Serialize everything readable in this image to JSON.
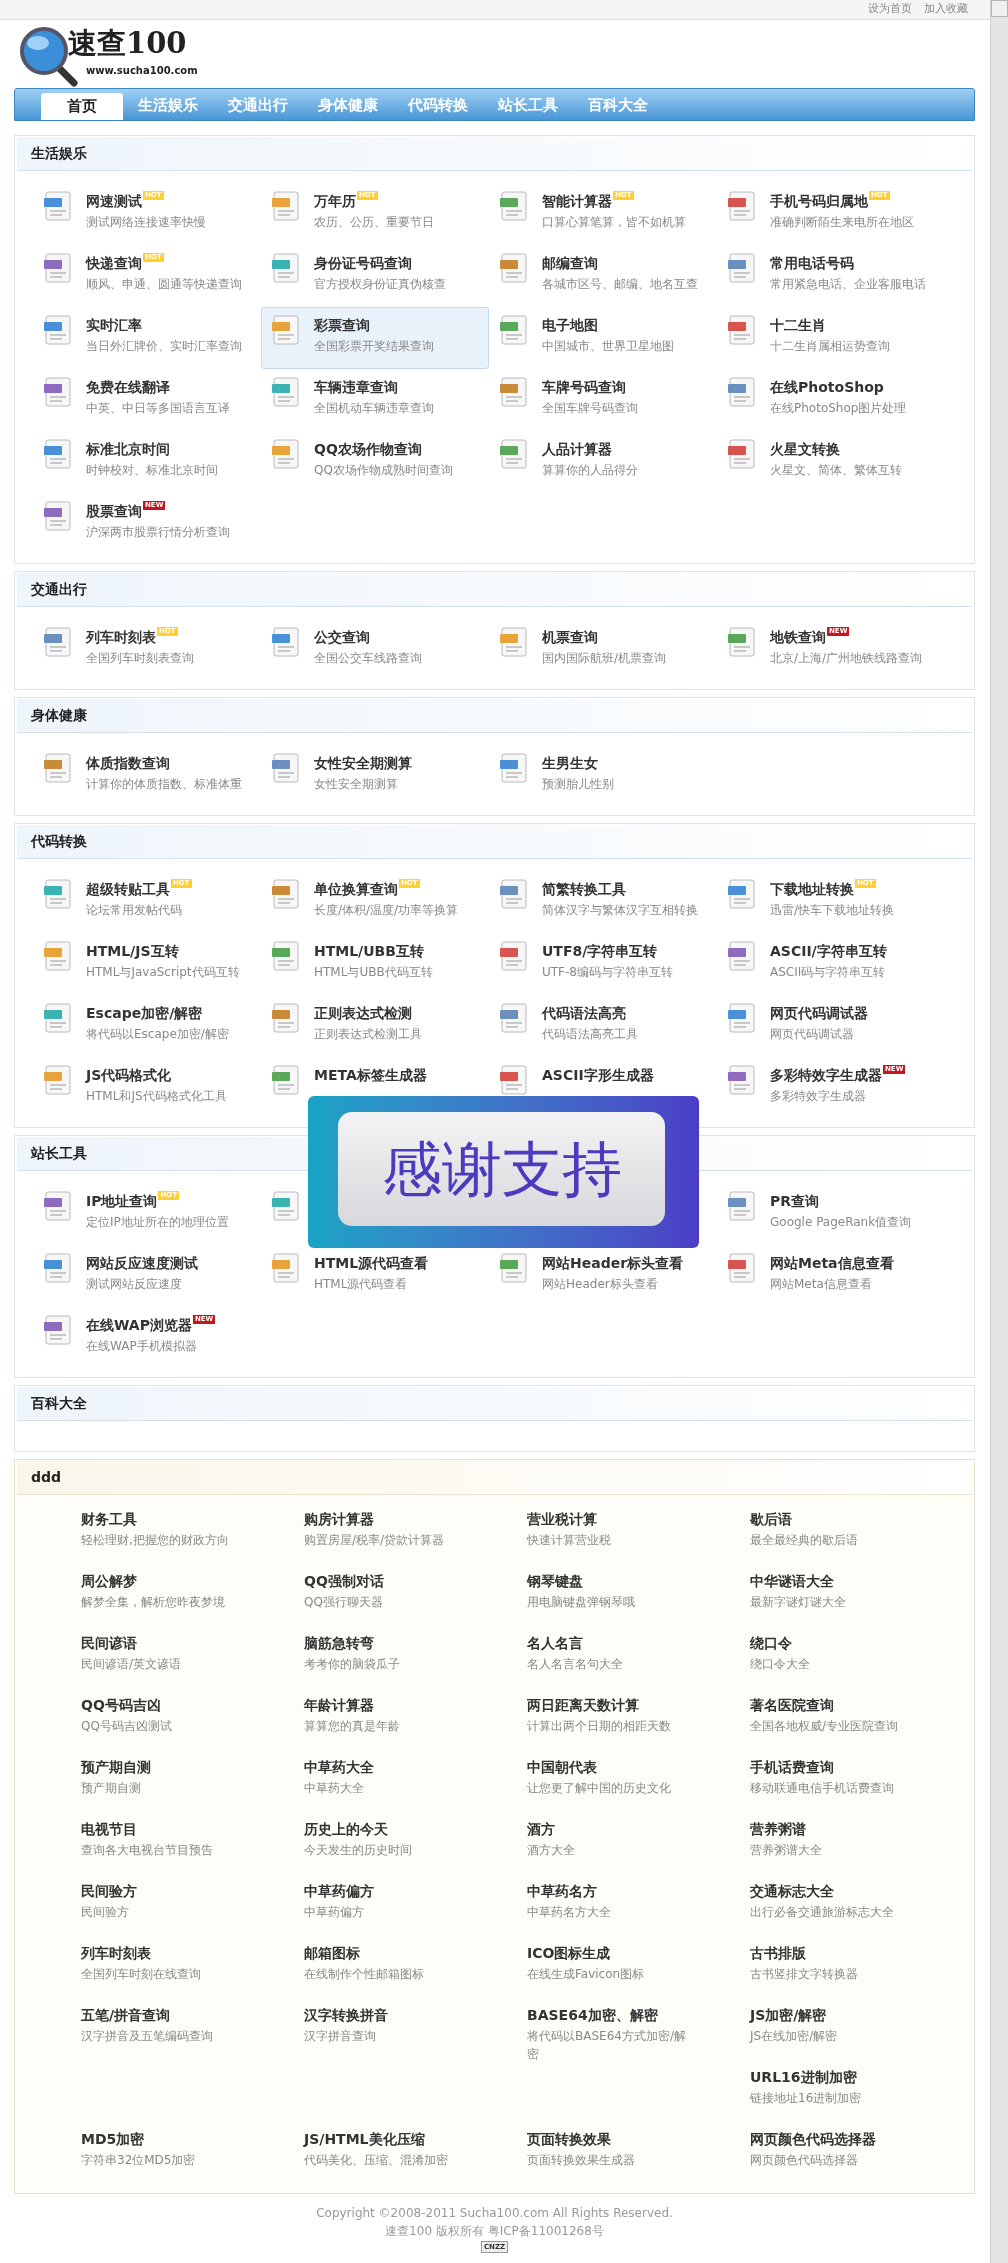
{
  "top_links": [
    "设为首页",
    "加入收藏"
  ],
  "logo": {
    "title": "速查100",
    "url": "www.sucha100.com"
  },
  "nav": {
    "tabs": [
      {
        "label": "首页",
        "selected": true
      },
      {
        "label": "生活娱乐",
        "selected": false
      },
      {
        "label": "交通出行",
        "selected": false
      },
      {
        "label": "身体健康",
        "selected": false
      },
      {
        "label": "代码转换",
        "selected": false
      },
      {
        "label": "站长工具",
        "selected": false
      },
      {
        "label": "百科大全",
        "selected": false
      }
    ]
  },
  "sections": [
    {
      "title": "生活娱乐",
      "kind": "icons",
      "items": [
        {
          "title": "网速测试",
          "badge": {
            "kind": "hot",
            "text": "HOT"
          },
          "desc": "测试网络连接速率快慢",
          "selected": false
        },
        {
          "title": "万年历",
          "badge": {
            "kind": "hot",
            "text": "HOT"
          },
          "desc": "农历、公历、重要节日",
          "selected": false
        },
        {
          "title": "智能计算器",
          "badge": {
            "kind": "hot",
            "text": "HOT"
          },
          "desc": "口算心算笔算，皆不如机算",
          "selected": false
        },
        {
          "title": "手机号码归属地",
          "badge": {
            "kind": "hot",
            "text": "HOT"
          },
          "desc": "准确判断陌生来电所在地区",
          "selected": false
        },
        {
          "title": "快递查询",
          "badge": {
            "kind": "hot",
            "text": "HOT"
          },
          "desc": "顺风、申通、圆通等快递查询",
          "selected": false
        },
        {
          "title": "身份证号码查询",
          "desc": "官方授权身份证真伪核查",
          "selected": false
        },
        {
          "title": "邮编查询",
          "desc": "各城市区号、邮编、地名互查",
          "selected": false
        },
        {
          "title": "常用电话号码",
          "desc": "常用紧急电话、企业客服电话",
          "selected": false
        },
        {
          "title": "实时汇率",
          "desc": "当日外汇牌价、实时汇率查询",
          "selected": false
        },
        {
          "title": "彩票查询",
          "desc": "全国彩票开奖结果查询",
          "selected": true
        },
        {
          "title": "电子地图",
          "desc": "中国城市、世界卫星地图",
          "selected": false
        },
        {
          "title": "十二生肖",
          "desc": "十二生肖属相运势查询",
          "selected": false
        },
        {
          "title": "免费在线翻译",
          "desc": "中英、中日等多国语言互译",
          "selected": false
        },
        {
          "title": "车辆违章查询",
          "desc": "全国机动车辆违章查询",
          "selected": false
        },
        {
          "title": "车牌号码查询",
          "desc": "全国车牌号码查询",
          "selected": false
        },
        {
          "title": "在线PhotoShop",
          "desc": "在线PhotoShop图片处理",
          "selected": false
        },
        {
          "title": "标准北京时间",
          "desc": "时钟校对、标准北京时间",
          "selected": false
        },
        {
          "title": "QQ农场作物查询",
          "desc": "QQ农场作物成熟时间查询",
          "selected": false
        },
        {
          "title": "人品计算器",
          "desc": "算算你的人品得分",
          "selected": false
        },
        {
          "title": "火星文转换",
          "desc": "火星文、简体、繁体互转",
          "selected": false
        },
        {
          "title": "股票查询",
          "badge": {
            "kind": "new",
            "text": "NEW"
          },
          "desc": "沪深两市股票行情分析查询",
          "selected": false
        }
      ]
    },
    {
      "title": "交通出行",
      "kind": "icons",
      "items": [
        {
          "title": "列车时刻表",
          "badge": {
            "kind": "hot",
            "text": "HOT"
          },
          "desc": "全国列车时刻表查询"
        },
        {
          "title": "公交查询",
          "desc": "全国公交车线路查询"
        },
        {
          "title": "机票查询",
          "desc": "国内国际航班/机票查询"
        },
        {
          "title": "地铁查询",
          "badge": {
            "kind": "new",
            "text": "NEW"
          },
          "desc": "北京/上海/广州地铁线路查询"
        }
      ]
    },
    {
      "title": "身体健康",
      "kind": "icons",
      "items": [
        {
          "title": "体质指数查询",
          "desc": "计算你的体质指数、标准体重"
        },
        {
          "title": "女性安全期测算",
          "desc": "女性安全期测算"
        },
        {
          "title": "生男生女",
          "desc": "预测胎儿性别"
        }
      ]
    },
    {
      "title": "代码转换",
      "kind": "icons",
      "items": [
        {
          "title": "超级转贴工具",
          "badge": {
            "kind": "hot",
            "text": "HOT"
          },
          "desc": "论坛常用发帖代码"
        },
        {
          "title": "单位换算查询",
          "badge": {
            "kind": "hot",
            "text": "HOT"
          },
          "desc": "长度/体积/温度/功率等换算"
        },
        {
          "title": "简繁转换工具",
          "desc": "简体汉字与繁体汉字互相转换"
        },
        {
          "title": "下载地址转换",
          "badge": {
            "kind": "hot",
            "text": "HOT"
          },
          "desc": "迅雷/快车下载地址转换"
        },
        {
          "title": "HTML/JS互转",
          "desc": "HTML与JavaScript代码互转"
        },
        {
          "title": "HTML/UBB互转",
          "desc": "HTML与UBB代码互转"
        },
        {
          "title": "UTF8/字符串互转",
          "desc": "UTF-8编码与字符串互转"
        },
        {
          "title": "ASCII/字符串互转",
          "desc": "ASCII码与字符串互转"
        },
        {
          "title": "Escape加密/解密",
          "desc": "将代码以Escape加密/解密"
        },
        {
          "title": "正则表达式检测",
          "desc": "正则表达式检测工具"
        },
        {
          "title": "代码语法高亮",
          "desc": "代码语法高亮工具"
        },
        {
          "title": "网页代码调试器",
          "desc": "网页代码调试器"
        },
        {
          "title": "JS代码格式化",
          "desc": "HTML和JS代码格式化工具"
        },
        {
          "title": "META标签生成器"
        },
        {
          "title": "ASCII字形生成器"
        },
        {
          "title": "多彩特效字生成器",
          "badge": {
            "kind": "new",
            "text": "NEW"
          },
          "desc": "多彩特效字生成器"
        }
      ]
    },
    {
      "title": "站长工具",
      "kind": "icons",
      "items": [
        {
          "kind": "tool",
          "title": "IP地址查询",
          "badge": {
            "kind": "hot",
            "text": "HOT"
          },
          "desc": "定位IP地址所在的地理位置"
        },
        {
          "kind": "icon_only"
        },
        {
          "kind": "covered"
        },
        {
          "kind": "tool",
          "title": "PR查询",
          "desc": "Google PageRank值查询"
        },
        {
          "kind": "tool",
          "title": "网站反应速度测试",
          "desc": "测试网站反应速度"
        },
        {
          "kind": "tool",
          "title": "HTML源代码查看",
          "desc": "HTML源代码查看"
        },
        {
          "kind": "tool",
          "title": "网站Header标头查看",
          "desc": "网站Header标头查看"
        },
        {
          "kind": "tool",
          "title": "网站Meta信息查看",
          "desc": "网站Meta信息查看"
        },
        {
          "kind": "tool",
          "title": "在线WAP浏览器",
          "badge": {
            "kind": "new",
            "text": "NEW"
          },
          "desc": "在线WAP手机模拟器"
        }
      ]
    },
    {
      "title": "百科大全",
      "kind": "icons"
    },
    {
      "title": "ddd",
      "kind": "plain",
      "items": [
        {
          "title": "财务工具",
          "desc": "轻松理财,把握您的财政方向"
        },
        {
          "title": "购房计算器",
          "desc": "购置房屋/税率/贷款计算器"
        },
        {
          "title": "营业税计算",
          "desc": "快速计算营业税"
        },
        {
          "title": "歇后语",
          "desc": "最全最经典的歇后语"
        },
        {
          "title": "周公解梦",
          "desc": "解梦全集，解析您昨夜梦境"
        },
        {
          "title": "QQ强制对话",
          "desc": "QQ强行聊天器"
        },
        {
          "title": "钢琴键盘",
          "desc": "用电脑键盘弹钢琴哦"
        },
        {
          "title": "中华谜语大全",
          "desc": "最新字谜灯谜大全"
        },
        {
          "title": "民间谚语",
          "desc": "民间谚语/英文谚语"
        },
        {
          "title": "脑筋急转弯",
          "desc": "考考你的脑袋瓜子"
        },
        {
          "title": "名人名言",
          "desc": "名人名言名句大全"
        },
        {
          "title": "绕口令",
          "desc": "绕口令大全"
        },
        {
          "title": "QQ号码吉凶",
          "desc": "QQ号码吉凶测试"
        },
        {
          "title": "年龄计算器",
          "desc": "算算您的真是年龄"
        },
        {
          "title": "两日距离天数计算",
          "desc": "计算出两个日期的相距天数"
        },
        {
          "title": "著名医院查询",
          "desc": "全国各地权威/专业医院查询"
        },
        {
          "title": "预产期自测",
          "desc": "预产期自测"
        },
        {
          "title": "中草药大全",
          "desc": "中草药大全"
        },
        {
          "title": "中国朝代表",
          "desc": "让您更了解中国的历史文化"
        },
        {
          "title": "手机话费查询",
          "desc": "移动联通电信手机话费查询"
        },
        {
          "title": "电视节目",
          "desc": "查询各大电视台节目预告"
        },
        {
          "title": "历史上的今天",
          "desc": "今天发生的历史时间"
        },
        {
          "title": "酒方",
          "desc": "酒方大全"
        },
        {
          "title": "营养粥谱",
          "desc": "营养粥谱大全"
        },
        {
          "title": "民间验方",
          "desc": "民间验方"
        },
        {
          "title": "中草药偏方",
          "desc": "中草药偏方"
        },
        {
          "title": "中草药名方",
          "desc": "中草药名方大全"
        },
        {
          "title": "交通标志大全",
          "desc": "出行必备交通旅游标志大全"
        },
        {
          "title": "列车时刻表",
          "desc": "全国列车时刻在线查询"
        },
        {
          "title": "邮箱图标",
          "desc": "在线制作个性邮箱图标"
        },
        {
          "title": "ICO图标生成",
          "desc": "在线生成Favicon图标"
        },
        {
          "title": "古书排版",
          "desc": "古书竖排文字转换器"
        },
        {
          "title": "五笔/拼音查询",
          "desc": "汉字拼音及五笔编码查询"
        },
        {
          "title": "汉字转换拼音",
          "desc": "汉字拼音查询"
        },
        {
          "title": "BASE64加密、解密",
          "desc": "将代码以BASE64方式加密/解密"
        },
        {
          "title": "JS加密/解密",
          "desc": "JS在线加密/解密"
        },
        {
          "title": "URL16进制加密",
          "desc": "链接地址16进制加密"
        },
        {
          "title": "MD5加密",
          "desc": "字符串32位MD5加密"
        },
        {
          "title": "JS/HTML美化压缩",
          "desc": "代码美化、压缩、混淆加密"
        },
        {
          "title": "页面转换效果",
          "desc": "页面转换效果生成器"
        },
        {
          "title": "网页颜色代码选择器",
          "desc": "网页颜色代码选择器"
        }
      ]
    }
  ],
  "overlay": {
    "text": "感谢支持"
  },
  "footer": {
    "lines": [
      "Copyright ©2008-2011 Sucha100.com All Rights Reserved.",
      "速查100 版权所有 粤ICP备11001268号"
    ],
    "counter": "CNZZ"
  }
}
